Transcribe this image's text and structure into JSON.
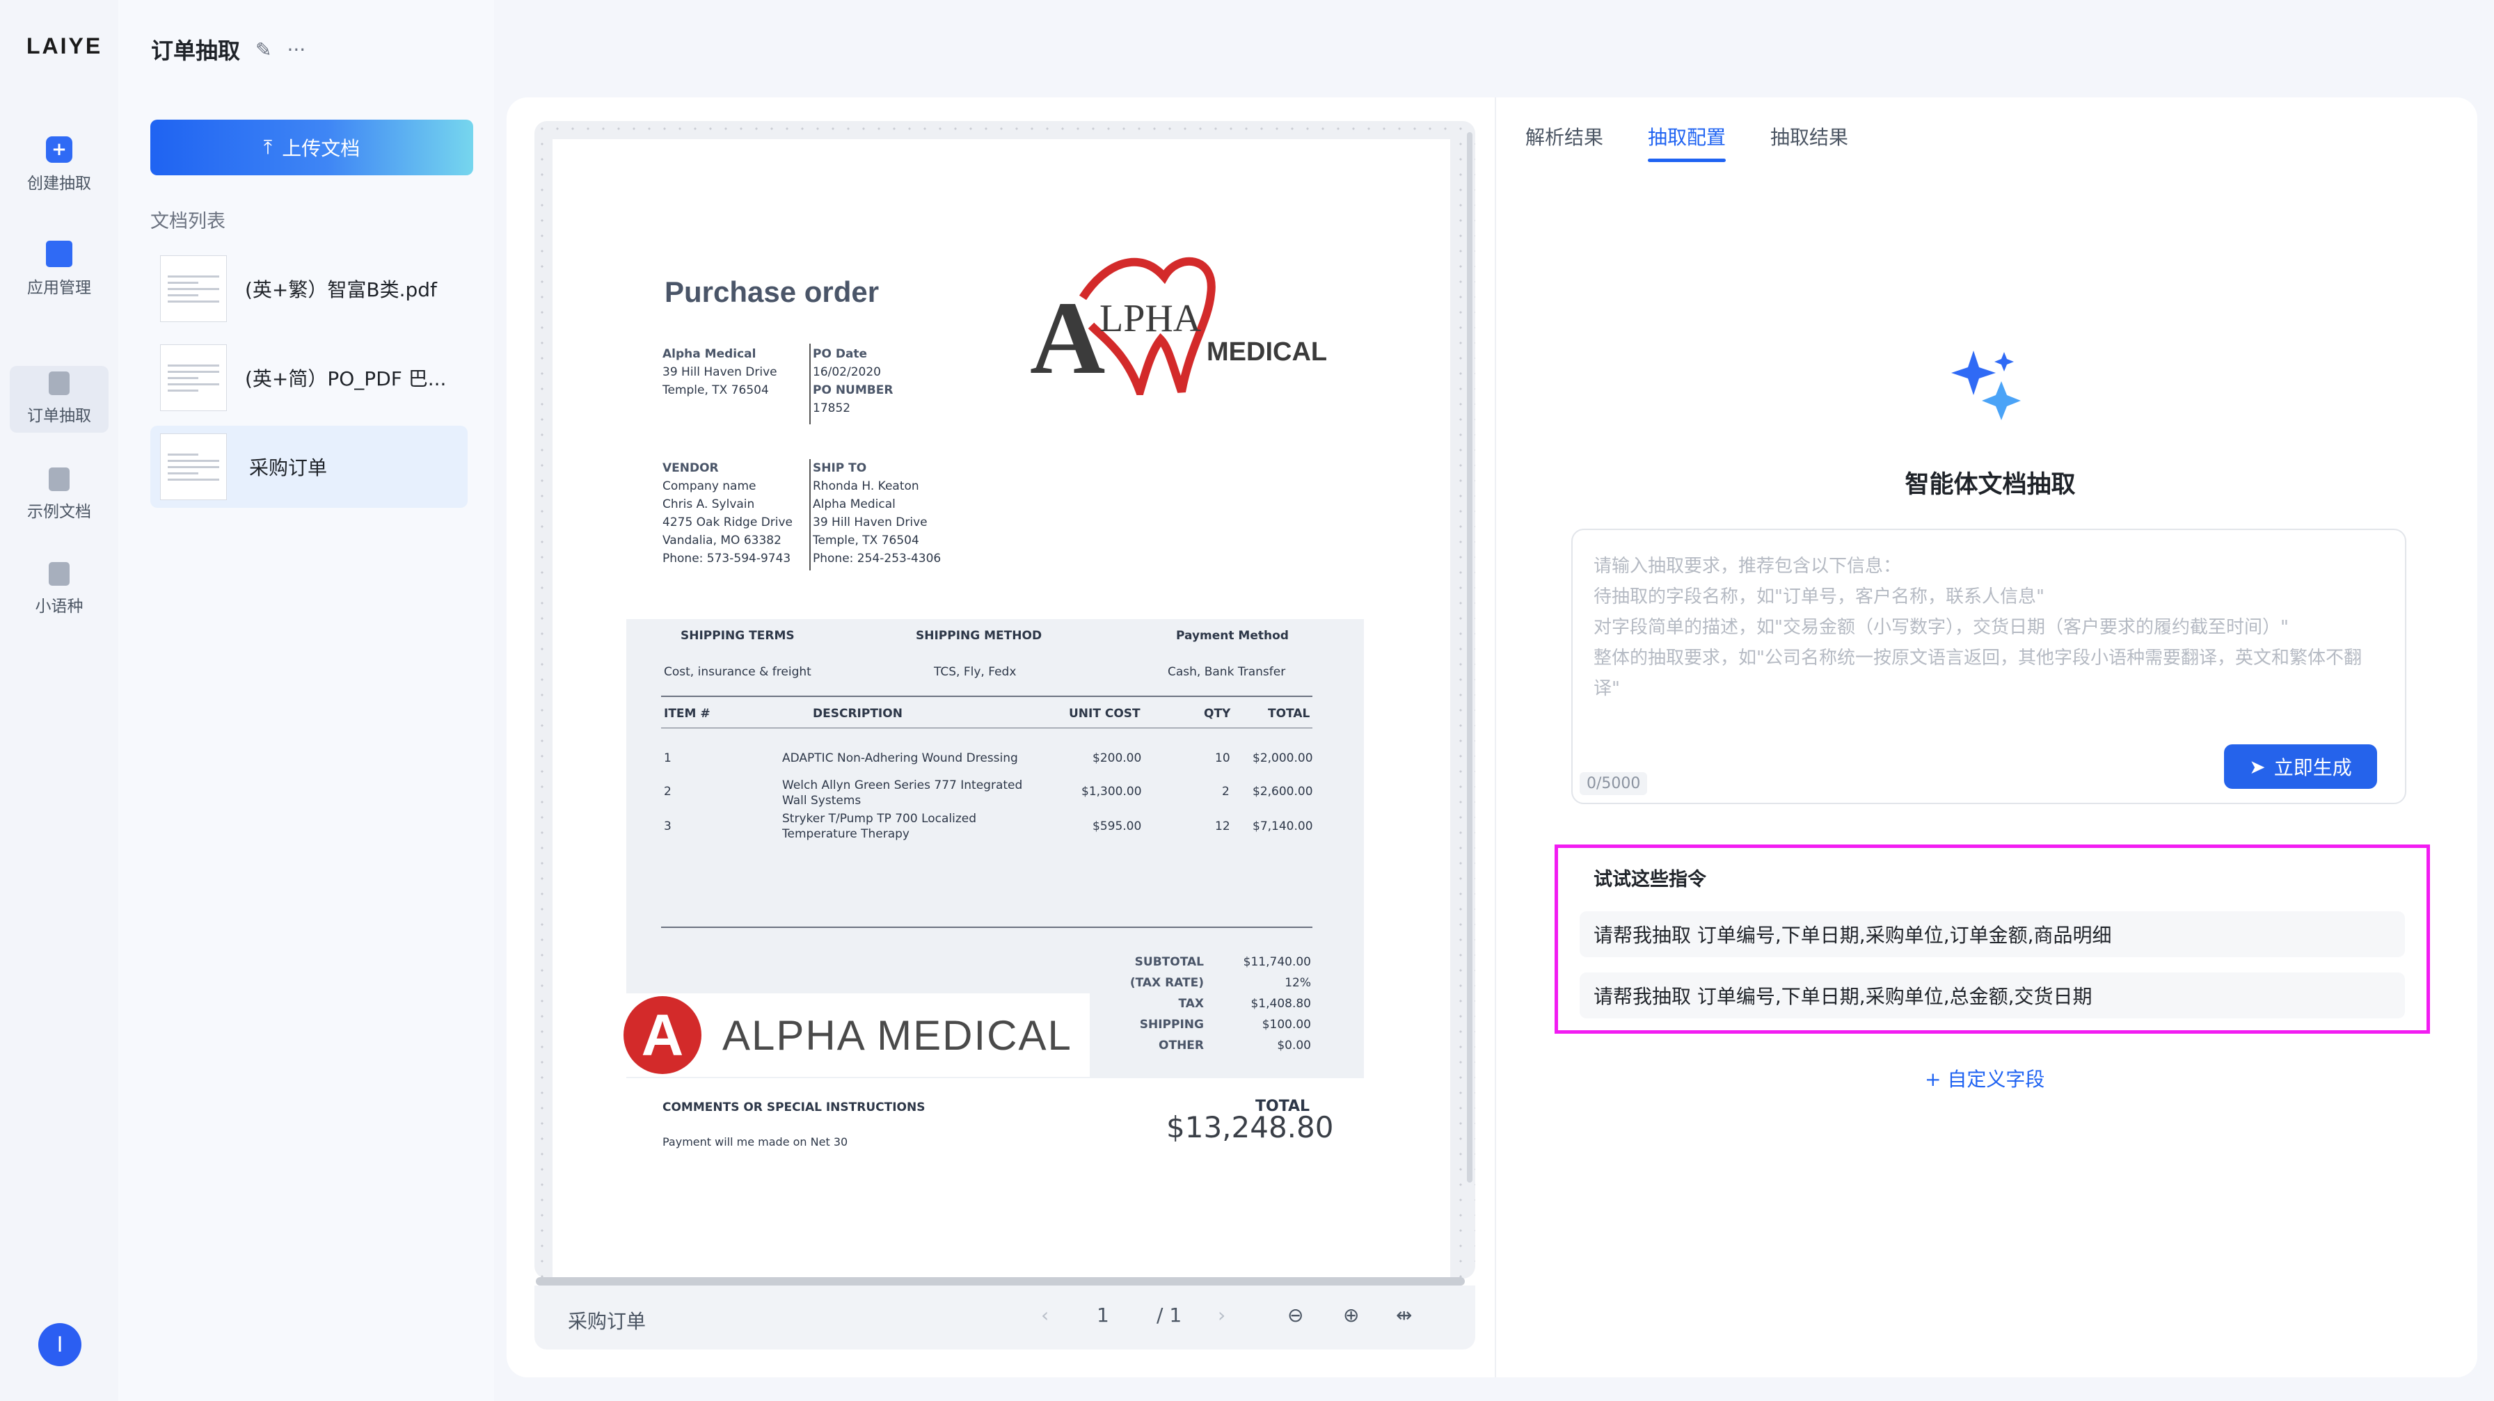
{
  "app": {
    "logo": "LAIYE",
    "nav": [
      {
        "label": "创建抽取",
        "icon": "plus-icon"
      },
      {
        "label": "应用管理",
        "icon": "folder-icon"
      },
      {
        "label": "订单抽取",
        "icon": "document-edit-icon",
        "active": true
      },
      {
        "label": "示例文档",
        "icon": "document-edit-icon"
      },
      {
        "label": "小语种",
        "icon": "document-edit-icon"
      }
    ],
    "avatar_letter": "I"
  },
  "doc_panel": {
    "title": "订单抽取",
    "upload_label": "上传文档",
    "list_label": "文档列表",
    "documents": [
      {
        "name": "(英+繁）智富B类.pdf"
      },
      {
        "name": "(英+简）PO_PDF 巴..."
      },
      {
        "name": "采购订单",
        "active": true
      }
    ]
  },
  "viewer": {
    "file_name": "采购订单",
    "page_current": "1",
    "page_total": "/ 1",
    "prev_icon": "chevron-left-icon",
    "next_icon": "chevron-right-icon"
  },
  "purchase_order": {
    "title": "Purchase order",
    "bill_from": [
      "Alpha Medical",
      "39 Hill Haven Drive",
      "Temple, TX 76504"
    ],
    "po_date_label": "PO Date",
    "po_date": "16/02/2020",
    "po_number_label": "PO NUMBER",
    "po_number": "17852",
    "vendor_label": "VENDOR",
    "vendor": [
      "Company name",
      "Chris A. Sylvain",
      "4275 Oak Ridge Drive",
      "Vandalia, MO 63382",
      "Phone: 573-594-9743"
    ],
    "ship_to_label": "SHIP TO",
    "ship_to": [
      "Rhonda H. Keaton",
      "Alpha Medical",
      "39 Hill Haven Drive",
      "Temple, TX 76504",
      "Phone: 254-253-4306"
    ],
    "terms_headers": [
      "SHIPPING TERMS",
      "SHIPPING METHOD",
      "Payment Method"
    ],
    "terms_values": [
      "Cost, insurance & freight",
      "TCS, Fly, Fedx",
      "Cash, Bank Transfer"
    ],
    "item_headers": [
      "ITEM #",
      "DESCRIPTION",
      "UNIT COST",
      "QTY",
      "TOTAL"
    ],
    "items": [
      {
        "no": "1",
        "desc": "ADAPTIC Non-Adhering Wound Dressing",
        "desc2": "",
        "unit": "$200.00",
        "qty": "10",
        "total": "$2,000.00"
      },
      {
        "no": "2",
        "desc": "Welch Allyn Green Series 777 Integrated",
        "desc2": "Wall Systems",
        "unit": "$1,300.00",
        "qty": "2",
        "total": "$2,600.00"
      },
      {
        "no": "3",
        "desc": "Stryker T/Pump TP 700 Localized",
        "desc2": "Temperature Therapy",
        "unit": "$595.00",
        "qty": "12",
        "total": "$7,140.00"
      }
    ],
    "summary": [
      {
        "label": "SUBTOTAL",
        "value": "$11,740.00"
      },
      {
        "label": "(TAX RATE)",
        "value": "12%"
      },
      {
        "label": "TAX",
        "value": "$1,408.80"
      },
      {
        "label": "SHIPPING",
        "value": "$100.00"
      },
      {
        "label": "OTHER",
        "value": "$0.00"
      }
    ],
    "comments_label": "COMMENTS OR SPECIAL INSTRUCTIONS",
    "comments": "Payment will me made on Net 30",
    "total_label": "TOTAL",
    "total_value": "$13,248.80",
    "logo_top_lpha": "LPHA",
    "logo_top_a": "A",
    "logo_top_medical": "MEDICAL",
    "logo_bottom_letter": "A",
    "logo_bottom_text": "ALPHA MEDICAL"
  },
  "right_panel": {
    "tabs": [
      "解析结果",
      "抽取配置",
      "抽取结果"
    ],
    "active_tab": "抽取配置",
    "agent_title": "智能体文档抽取",
    "placeholder": "请输入抽取要求，推荐包含以下信息：\n待抽取的字段名称，如\"订单号，客户名称，联系人信息\"\n对字段简单的描述，如\"交易金额（小写数字），交货日期（客户要求的履约截至时间）\"\n整体的抽取要求，如\"公司名称统一按原文语言返回，其他字段小语种需要翻译，英文和繁体不翻译\"",
    "counter": "0/5000",
    "generate_label": "立即生成",
    "suggestions_title": "试试这些指令",
    "suggestions": [
      "请帮我抽取 订单编号,下单日期,采购单位,订单金额,商品明细",
      "请帮我抽取 订单编号,下单日期,采购单位,总金额,交货日期"
    ],
    "custom_field_label": "+ 自定义字段"
  },
  "colors": {
    "primary": "#1f63f2",
    "highlight_border": "#f21cf2",
    "logo_red": "#d32a2a"
  }
}
